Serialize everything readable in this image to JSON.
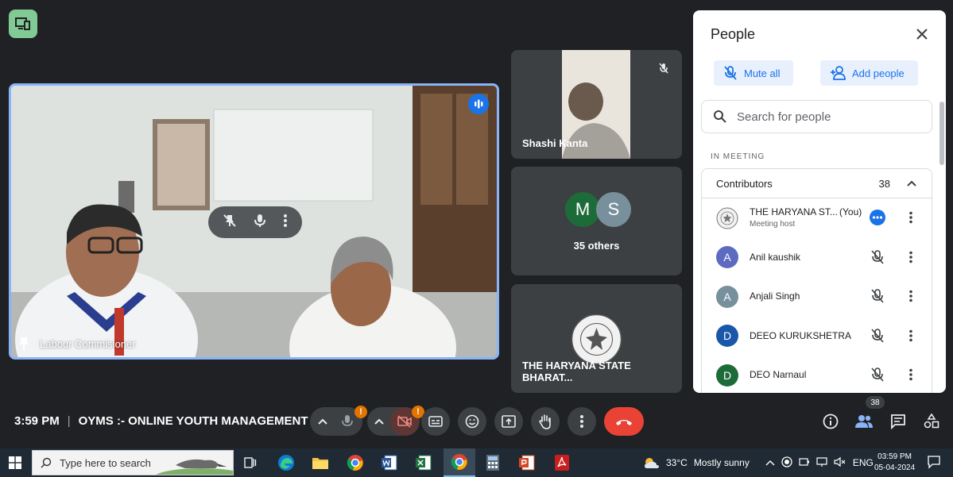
{
  "meeting": {
    "time": "3:59 PM",
    "title": "OYMS :- ONLINE YOUTH MANAGEMENT ...",
    "separator": "|"
  },
  "main_tile": {
    "name": "Labour Commisioner"
  },
  "side_tiles": {
    "t1_name": "Shashi Kanta",
    "t2_avatar1": "M",
    "t2_avatar2": "S",
    "t2_label": "35 others",
    "t3_name": "THE HARYANA STATE BHARAT..."
  },
  "people_panel": {
    "title": "People",
    "mute_all": "Mute all",
    "add_people": "Add people",
    "search_placeholder": "Search for people",
    "section": "IN MEETING",
    "contributors_label": "Contributors",
    "contributors_count": "38",
    "people": [
      {
        "initial": "",
        "name": "THE HARYANA ST...",
        "you": "(You)",
        "sub": "Meeting host",
        "color": "#ffffff"
      },
      {
        "initial": "A",
        "name": "Anil kaushik",
        "color": "#5c6bc0"
      },
      {
        "initial": "A",
        "name": "Anjali Singh",
        "color": "#78909c"
      },
      {
        "initial": "D",
        "name": "DEEO KURUKSHETRA",
        "color": "#1a57a8"
      },
      {
        "initial": "D",
        "name": "DEO Narnaul",
        "color": "#1e6b3a"
      }
    ]
  },
  "controls": {
    "people_count": "38",
    "warning": "!"
  },
  "taskbar": {
    "search_placeholder": "Type here to search",
    "temperature": "33°C",
    "weather": "Mostly sunny",
    "language": "ENG",
    "clock_time": "03:59 PM",
    "clock_date": "05-04-2024"
  },
  "colors": {
    "accent": "#8ab4f8",
    "end_call": "#ea4335",
    "present": "#81c995",
    "warning": "#e37400"
  }
}
